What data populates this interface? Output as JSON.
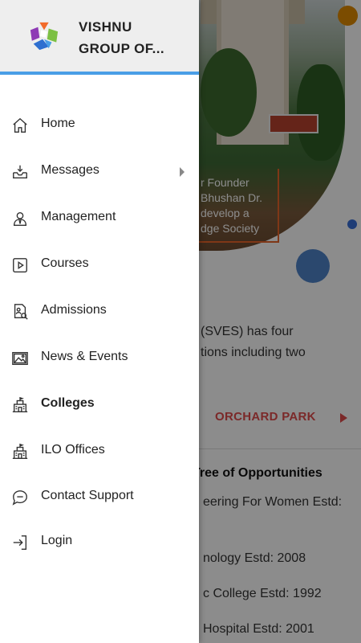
{
  "background": {
    "hero_caption": [
      "r Founder",
      "Bhushan Dr.",
      "develop a",
      "dge Society"
    ],
    "intro_text": [
      "(SVES) has four",
      "tions including two"
    ],
    "tab_label": "ORCHARD PARK",
    "section_title": "Tree of Opportunities",
    "lines": [
      "eering For Women Estd:",
      "nology Estd: 2008",
      "c College Estd: 1992",
      "Hospital Estd: 2001"
    ]
  },
  "drawer": {
    "brand_line1": "VISHNU",
    "brand_line2": "GROUP OF...",
    "items": [
      {
        "label": "Home",
        "icon": "home-icon"
      },
      {
        "label": "Messages",
        "icon": "inbox-icon",
        "has_submenu": true
      },
      {
        "label": "Management",
        "icon": "person-icon"
      },
      {
        "label": "Courses",
        "icon": "play-icon"
      },
      {
        "label": "Admissions",
        "icon": "admission-doc-icon"
      },
      {
        "label": "News & Events",
        "icon": "image-icon"
      },
      {
        "label": "Colleges",
        "icon": "building-icon",
        "active": true
      },
      {
        "label": "ILO Offices",
        "icon": "building-icon"
      },
      {
        "label": "Contact Support",
        "icon": "chat-icon"
      },
      {
        "label": "Login",
        "icon": "login-icon"
      }
    ]
  },
  "colors": {
    "accent_blue": "#4a9ee6",
    "orange": "#e08a00",
    "orchard_red": "#e04b4b"
  }
}
